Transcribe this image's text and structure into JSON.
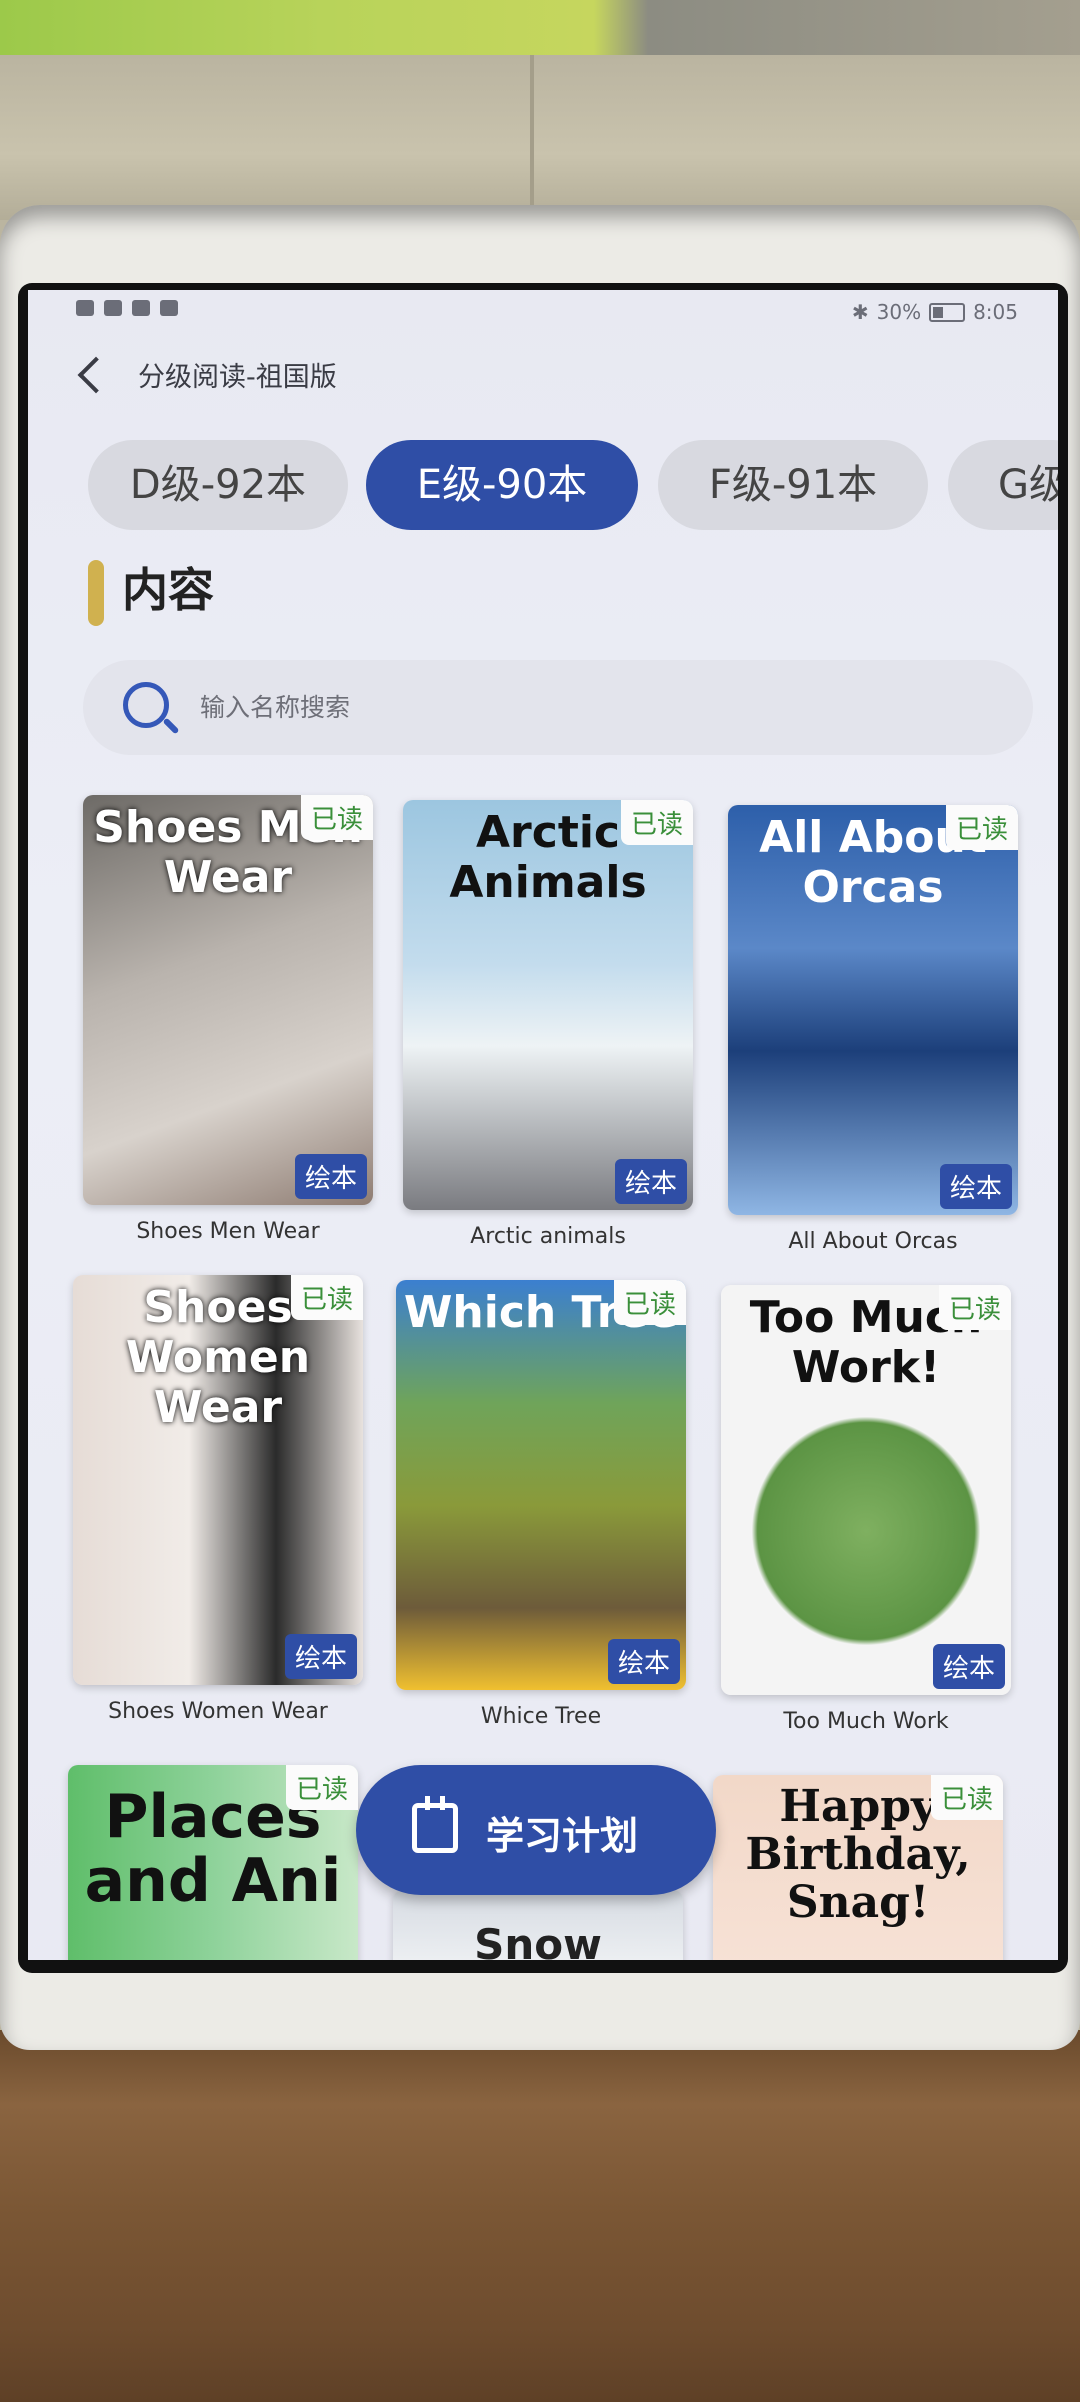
{
  "status_bar": {
    "battery": "30%",
    "time": "8:05"
  },
  "header": {
    "title": "分级阅读-祖国版"
  },
  "tabs": [
    {
      "label": "D级-92本"
    },
    {
      "label": "E级-90本"
    },
    {
      "label": "F级-91本"
    },
    {
      "label": "G级"
    }
  ],
  "section": {
    "title": "内容"
  },
  "search": {
    "placeholder": "输入名称搜索"
  },
  "books": [
    {
      "cover_title": "Shoes Men Wear",
      "name": "Shoes Men Wear",
      "read": "已读",
      "type": "绘本"
    },
    {
      "cover_title": "Arctic Animals",
      "name": "Arctic animals",
      "read": "已读",
      "type": "绘本"
    },
    {
      "cover_title": "All About Orcas",
      "name": "All About Orcas",
      "read": "已读",
      "type": "绘本"
    },
    {
      "cover_title": "Shoes Women Wear",
      "name": "Shoes Women Wear",
      "read": "已读",
      "type": "绘本"
    },
    {
      "cover_title": "Which Tree",
      "name": "Whice Tree",
      "read": "已读",
      "type": "绘本"
    },
    {
      "cover_title": "Too Much Work!",
      "name": "Too Much Work",
      "read": "已读",
      "type": "绘本"
    },
    {
      "cover_title": "Places and Ani",
      "name": "",
      "read": "已读",
      "type": ""
    },
    {
      "cover_title": "Snow",
      "name": "",
      "read": "",
      "type": ""
    },
    {
      "cover_title": "Happy Birthday, Snag!",
      "name": "",
      "read": "已读",
      "type": ""
    }
  ],
  "plan_button": {
    "label": "学习计划"
  }
}
